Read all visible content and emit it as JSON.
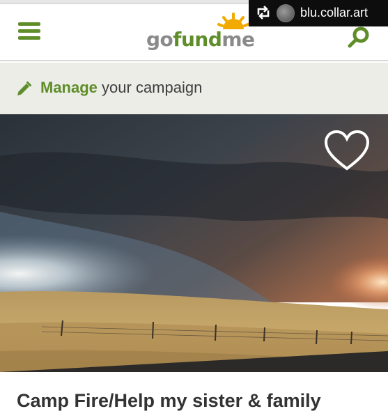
{
  "header": {
    "menu_icon": "hamburger-menu-icon",
    "logo": {
      "part_go": "go",
      "part_fund": "fund",
      "part_me": "me"
    },
    "search_icon": "search-icon"
  },
  "repost": {
    "icon": "repost-icon",
    "username": "blu.collar.art"
  },
  "manage_bar": {
    "icon": "pencil-icon",
    "strong_label": "Manage",
    "rest_label": " your campaign"
  },
  "campaign": {
    "favorite_icon": "heart-icon",
    "title": "Camp Fire/Help my sister & family"
  },
  "colors": {
    "brand_green": "#5f8d2a",
    "manage_bar_bg": "#ebede6",
    "logo_sun": "#f2a900",
    "text_dark": "#333333"
  }
}
